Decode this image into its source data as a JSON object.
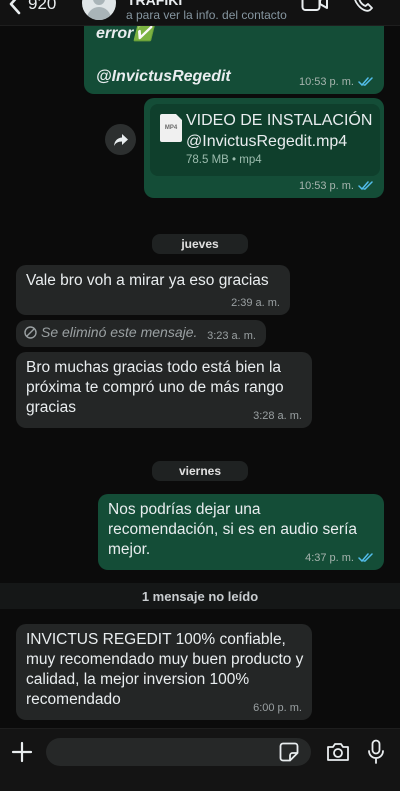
{
  "header": {
    "back_count": "920",
    "contact_name": "TRAFIKI",
    "contact_subtitle": "a para ver la info. del contacto"
  },
  "messages": [
    {
      "type": "text",
      "direction": "out",
      "text_line1": "error✅",
      "text_line2": "@InvictusRegedit",
      "time": "10:53 p. m."
    },
    {
      "type": "document",
      "direction": "out",
      "file_name": "VIDEO DE INSTALACIÓN @InvictusRegedit.mp4",
      "file_info": "78.5 MB • mp4",
      "file_ext": "MP4",
      "time": "10:53 p. m."
    },
    {
      "type": "date",
      "label": "jueves"
    },
    {
      "type": "text",
      "direction": "in",
      "text": "Vale bro voh a mirar ya eso gracias",
      "time": "2:39 a. m."
    },
    {
      "type": "deleted",
      "direction": "in",
      "text": "Se eliminó este mensaje.",
      "time": "3:23 a. m."
    },
    {
      "type": "text",
      "direction": "in",
      "text": "Bro muchas gracias todo está bien la próxima te compró uno de más rango gracias",
      "time": "3:28 a. m."
    },
    {
      "type": "date",
      "label": "viernes"
    },
    {
      "type": "text",
      "direction": "out",
      "text": "Nos podrías dejar una recomendación, si es en audio sería mejor.",
      "time": "4:37 p. m."
    },
    {
      "type": "unread",
      "label": "1 mensaje no leído"
    },
    {
      "type": "text",
      "direction": "in",
      "text": "INVICTUS REGEDIT 100% confiable, muy recomendado muy buen producto y calidad, la mejor inversion 100% recomendado",
      "time": "6:00 p. m."
    }
  ],
  "colors": {
    "background": "#0b0b0b",
    "outgoing_bubble": "#144d37",
    "incoming_bubble": "#242626",
    "read_ticks": "#53bdeb"
  },
  "icons": [
    "back-chevron-icon",
    "avatar-icon",
    "video-call-icon",
    "phone-icon",
    "share-icon",
    "deleted-icon",
    "plus-icon",
    "sticker-icon",
    "camera-icon",
    "microphone-icon"
  ]
}
